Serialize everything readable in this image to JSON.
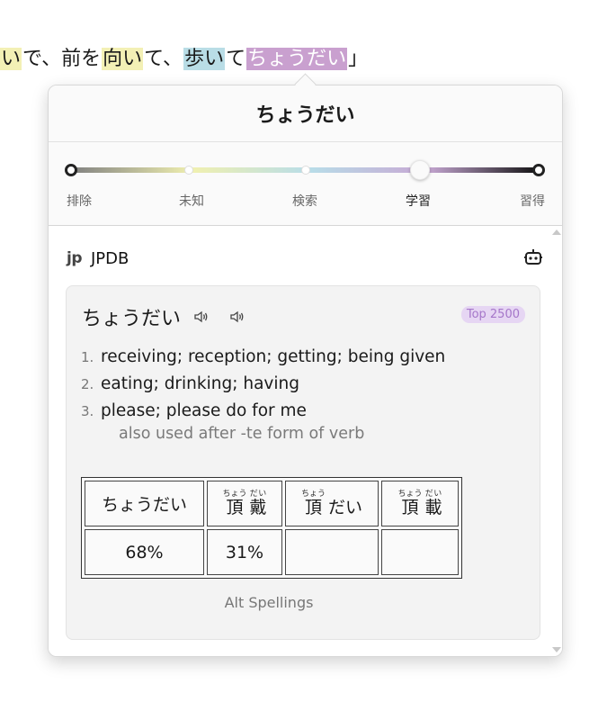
{
  "sentence": {
    "parts": [
      {
        "text": "い",
        "hl": "yellow"
      },
      {
        "text": "で、前を",
        "hl": ""
      },
      {
        "text": "向い",
        "hl": "yellow"
      },
      {
        "text": "て、",
        "hl": ""
      },
      {
        "text": "歩い",
        "hl": "blue"
      },
      {
        "text": "て",
        "hl": ""
      },
      {
        "text": "ちょうだい",
        "hl": "purple"
      },
      {
        "text": "」",
        "hl": ""
      }
    ]
  },
  "popup": {
    "title": "ちょうだい",
    "slider": {
      "labels": [
        "排除",
        "未知",
        "検索",
        "学習",
        "習得"
      ],
      "selected": "学習"
    },
    "source": {
      "logo_text": "jp",
      "name": "JPDB"
    },
    "entry": {
      "word": "ちょうだい",
      "badge": "Top 2500",
      "definitions": [
        {
          "num": "1.",
          "text": "receiving; reception; getting; being given"
        },
        {
          "num": "2.",
          "text": "eating; drinking; having"
        },
        {
          "num": "3.",
          "text": "please; please do for me"
        }
      ],
      "note": "also used after -te form of verb",
      "spellings": {
        "cells": [
          {
            "kind": "plain",
            "text": "ちょうだい",
            "pct": "68%"
          },
          {
            "kind": "ruby",
            "kanji": [
              "頂",
              "戴"
            ],
            "furigana": [
              "ちょう",
              "だい"
            ],
            "pct": "31%"
          },
          {
            "kind": "mixed",
            "kanji": "頂",
            "furigana": "ちょう",
            "kana": "だい",
            "pct": ""
          },
          {
            "kind": "ruby",
            "kanji": [
              "頂",
              "載"
            ],
            "furigana": [
              "ちょう",
              "だい"
            ],
            "pct": ""
          }
        ],
        "caption": "Alt Spellings"
      }
    }
  },
  "icons": {
    "speaker_1": "speaker-icon",
    "speaker_2": "speaker-icon",
    "robot": "robot-icon"
  },
  "colors": {
    "highlight_yellow": "#f3f0b5",
    "highlight_blue": "#b9dde6",
    "highlight_purple": "#c9a0cf",
    "badge_bg": "#e6d6f3",
    "badge_text": "#a576c9"
  }
}
